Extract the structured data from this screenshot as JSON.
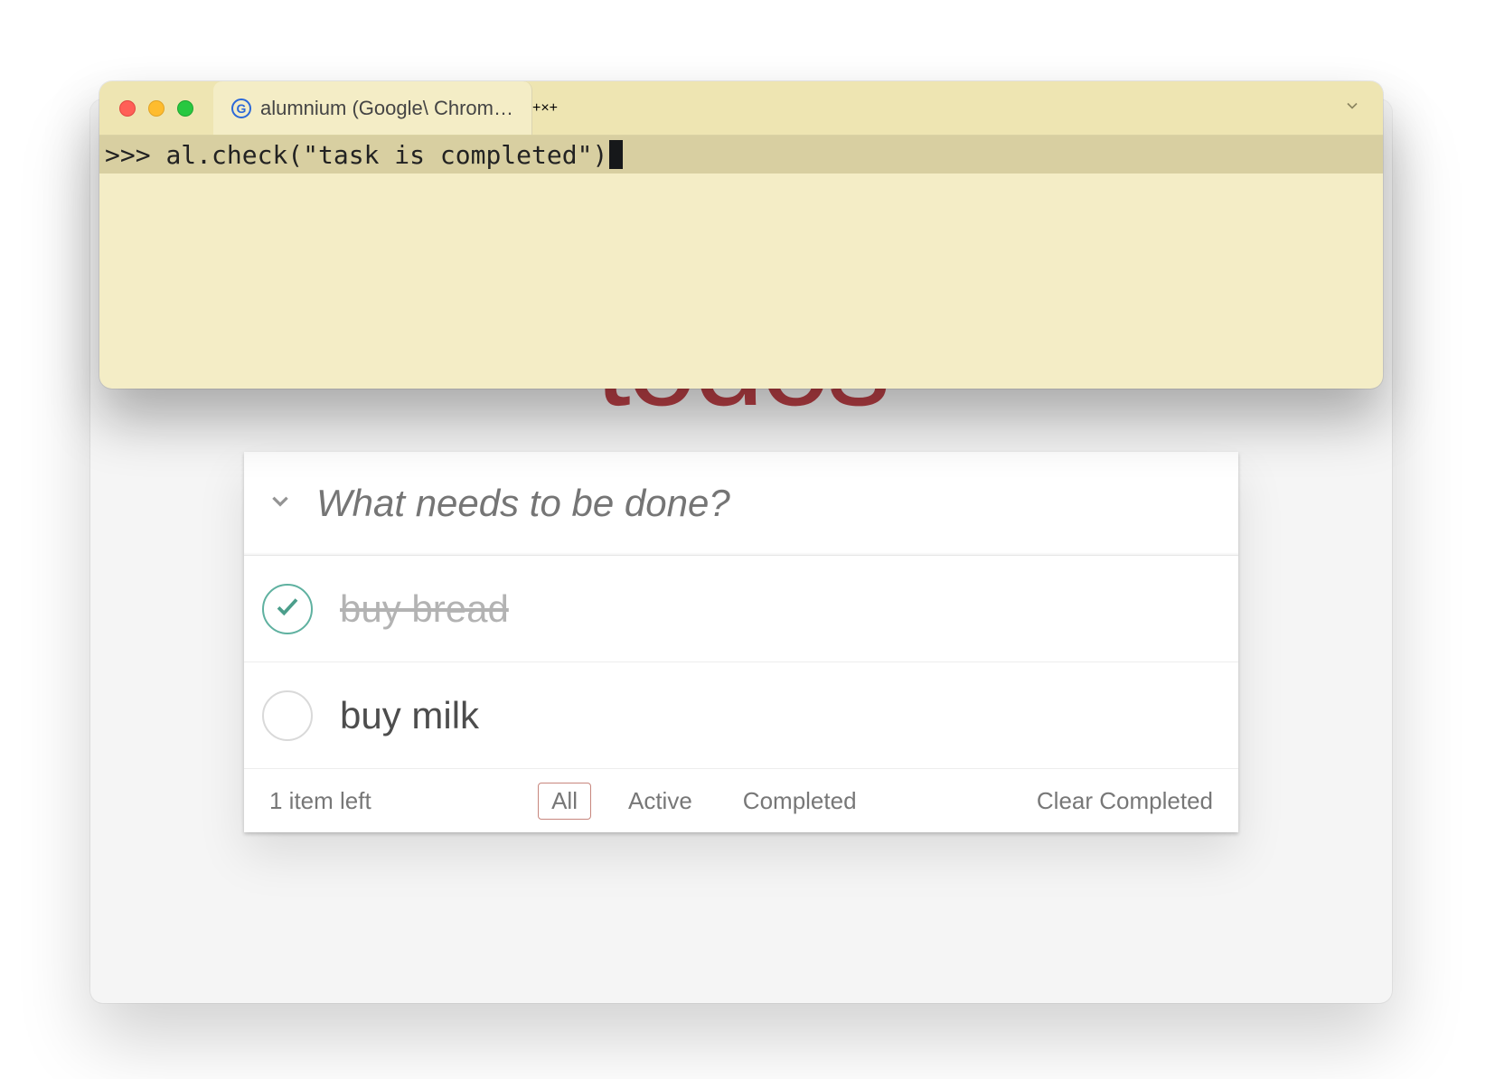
{
  "terminal": {
    "tab_title": "alumnium (Google\\ Chrom…",
    "prompt_prefix": ">>> ",
    "command": "al.check(\"task is completed\")"
  },
  "todo": {
    "app_title": "todos",
    "input_placeholder": "What needs to be done?",
    "items": [
      {
        "label": "buy bread",
        "completed": true
      },
      {
        "label": "buy milk",
        "completed": false
      }
    ],
    "count_text": "1 item left",
    "filters": {
      "all": "All",
      "active": "Active",
      "completed": "Completed"
    },
    "clear_completed": "Clear Completed"
  }
}
